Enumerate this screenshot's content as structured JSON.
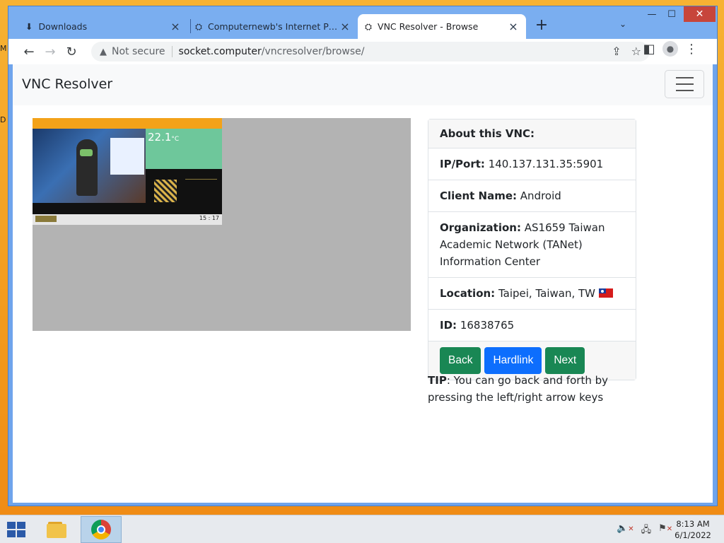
{
  "desktop": {
    "edge_text_1": "M",
    "edge_text_2": "D"
  },
  "browser": {
    "tabs": [
      {
        "title": "Downloads",
        "icon": "download-icon",
        "active": false
      },
      {
        "title": "Computernewb's Internet Pub Hub",
        "icon": "site-favicon",
        "active": false
      },
      {
        "title": "VNC Resolver - Browse",
        "icon": "site-favicon",
        "active": true
      }
    ],
    "new_tab_symbol": "+",
    "tab_search_symbol": "⌄",
    "window_controls": {
      "minimize": "—",
      "maximize": "☐",
      "close": "✕"
    },
    "toolbar": {
      "back": "←",
      "forward": "→",
      "reload": "↻",
      "security_label": "Not secure",
      "url_host": "socket.computer",
      "url_path": "/vncresolver/browse/"
    }
  },
  "page": {
    "brand": "VNC Resolver",
    "thumbnail": {
      "temperature": "22.1",
      "temperature_unit": "°C",
      "clock": "15 : 17"
    },
    "card": {
      "header": "About this VNC:",
      "rows": [
        {
          "label": "IP/Port:",
          "value": "140.137.131.35:5901"
        },
        {
          "label": "Client Name:",
          "value": "Android"
        },
        {
          "label": "Organization:",
          "value": "AS1659 Taiwan Academic Network (TANet) Information Center"
        },
        {
          "label": "Location:",
          "value": "Taipei, Taiwan, TW"
        },
        {
          "label": "ID:",
          "value": "16838765"
        }
      ],
      "buttons": {
        "back": "Back",
        "hardlink": "Hardlink",
        "next": "Next"
      }
    },
    "tip": {
      "label": "TIP",
      "text": ": You can go back and forth by pressing the left/right arrow keys"
    }
  },
  "taskbar": {
    "time": "8:13 AM",
    "date": "6/1/2022"
  },
  "colors": {
    "brand_green": "#198754",
    "brand_blue": "#0d6efd",
    "titlebar": "#7aaef0",
    "desktop": "#f5a021"
  }
}
